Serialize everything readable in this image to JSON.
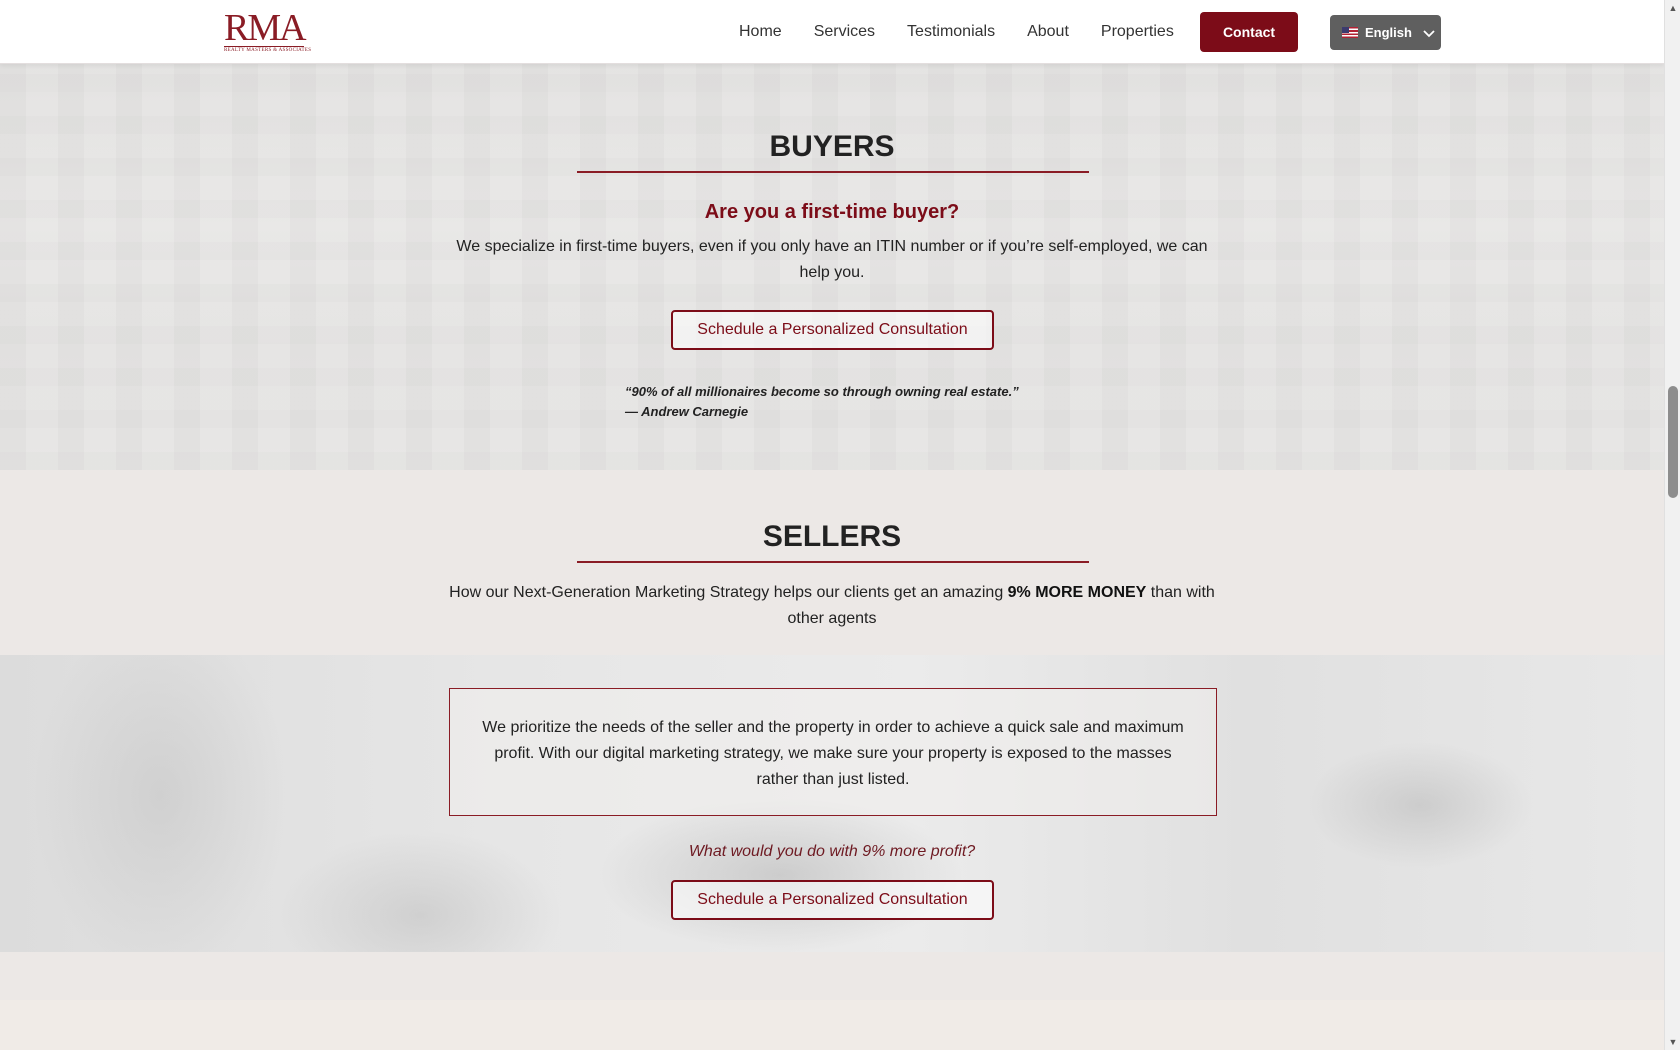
{
  "header": {
    "logo_text": "RMA",
    "logo_subtext": "REALTY MASTERS & ASSOCIATES",
    "nav": [
      {
        "label": "Home"
      },
      {
        "label": "Services"
      },
      {
        "label": "Testimonials"
      },
      {
        "label": "About"
      },
      {
        "label": "Properties"
      }
    ],
    "contact_label": "Contact",
    "language_label": "English"
  },
  "buyers": {
    "title": "BUYERS",
    "subtitle": "Are you a first-time buyer?",
    "text": "We specialize in first-time buyers, even if you only have an ITIN number or if you’re self-employed, we can help you.",
    "cta": "Schedule a Personalized Consultation",
    "quote": "“90% of all millionaires become so through owning real estate.”",
    "quote_author": "— Andrew Carnegie"
  },
  "sellers": {
    "title": "SELLERS",
    "intro_before": "How our Next-Generation Marketing Strategy helps our clients get an amazing ",
    "intro_bold": "9% MORE MONEY",
    "intro_after": " than with other agents",
    "box_text": "We prioritize the needs of the seller and the property in order to achieve a quick sale and maximum profit. With our digital marketing strategy, we make sure your property is exposed to the masses rather than just listed.",
    "question": "What would you do with 9% more profit?",
    "cta": "Schedule a Personalized Consultation"
  },
  "colors": {
    "accent": "#7c0c18",
    "page_bg": "#ece8e6",
    "language_button": "#5f5f5f"
  },
  "icons": {
    "language_flag": "us-flag-icon",
    "language_chevron": "chevron-down-icon"
  }
}
